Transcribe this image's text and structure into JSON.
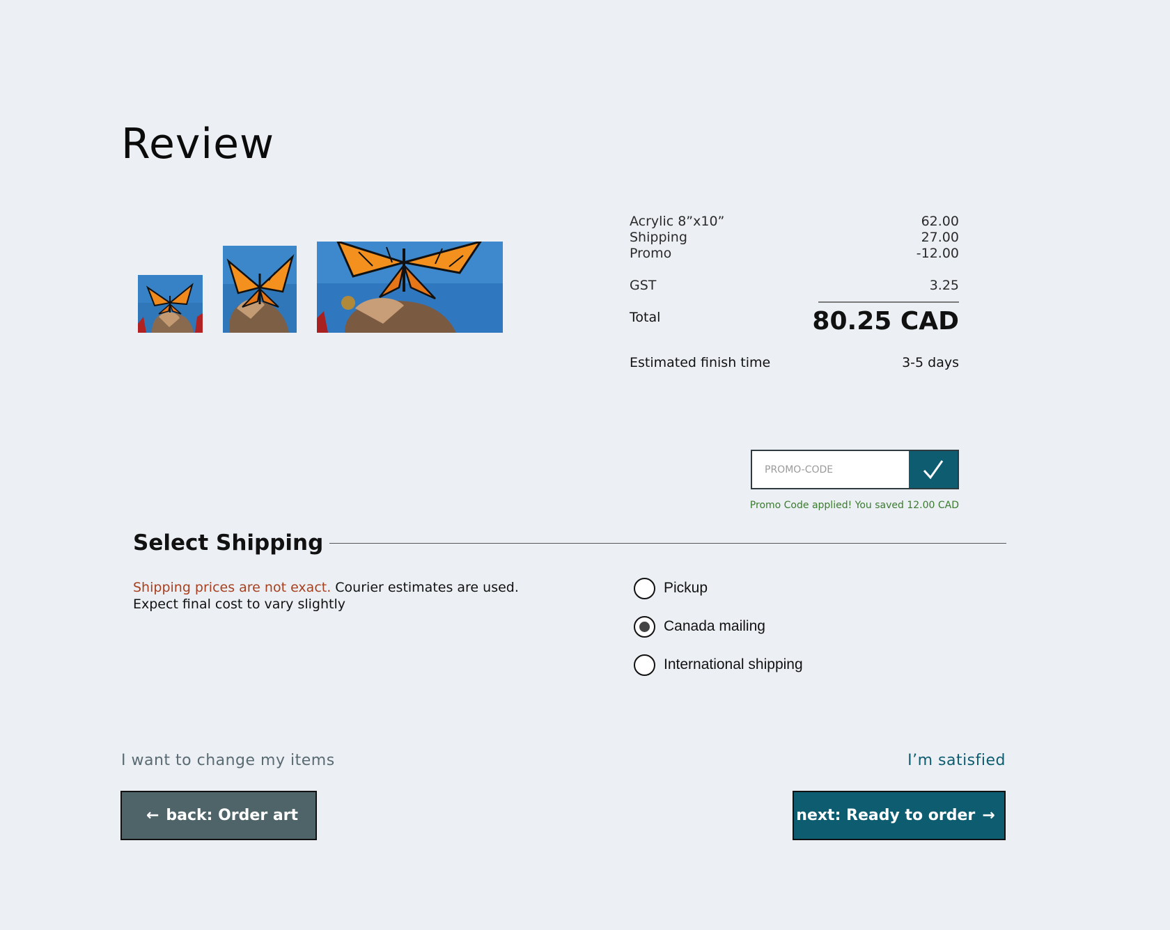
{
  "page": {
    "title": "Review"
  },
  "summary": {
    "items": [
      {
        "label": "Acrylic 8”x10”",
        "value": "62.00"
      },
      {
        "label": "Shipping",
        "value": "27.00"
      },
      {
        "label": "Promo",
        "value": "-12.00"
      }
    ],
    "gst": {
      "label": "GST",
      "value": "3.25"
    },
    "total": {
      "label": "Total",
      "value": "80.25 CAD"
    },
    "finish": {
      "label": "Estimated finish time",
      "value": "3-5 days"
    }
  },
  "promo": {
    "placeholder": "PROMO-CODE",
    "message": "Promo Code applied! You saved 12.00 CAD",
    "button_icon": "check-icon"
  },
  "shipping": {
    "title": "Select Shipping",
    "note_warning": "Shipping prices are not exact.",
    "note_rest": " Courier estimates are used.",
    "note_line2": "Expect final cost to vary slightly",
    "options": [
      {
        "label": "Pickup",
        "selected": false
      },
      {
        "label": "Canada mailing",
        "selected": true
      },
      {
        "label": "International shipping",
        "selected": false
      }
    ]
  },
  "nav": {
    "change_link": "I want to change my items",
    "satisfied_link": "I’m satisfied",
    "back_arrow": "←",
    "back_label": "back: Order art",
    "next_label": "next: Ready to order",
    "next_arrow": "→"
  },
  "colors": {
    "background": "#ecf0f4",
    "accent": "#0d5c70",
    "back_button": "#4f6469",
    "warning": "#a8401f",
    "success": "#3a7a2e"
  }
}
